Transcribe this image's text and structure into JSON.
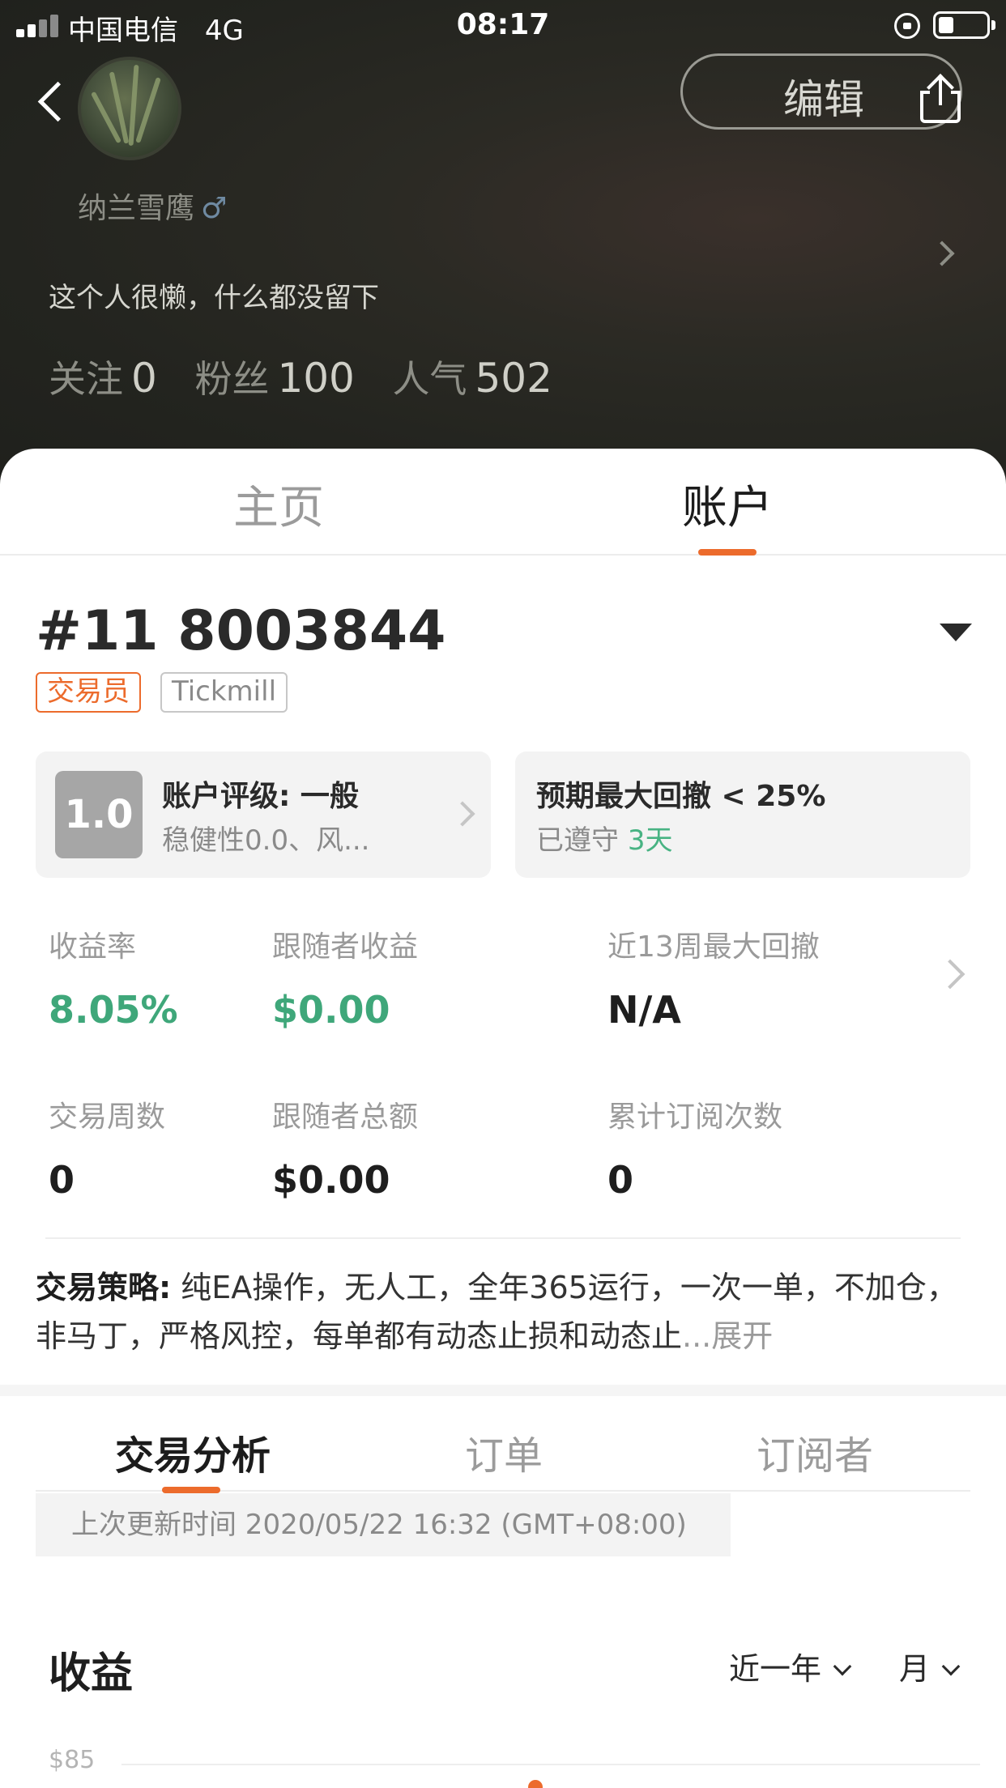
{
  "status_bar": {
    "carrier": "中国电信",
    "network": "4G",
    "time": "08:17"
  },
  "header": {
    "edit_label": "编辑",
    "username": "纳兰雪鹰",
    "gender_symbol": "♂",
    "bio": "这个人很懒，什么都没留下",
    "stats": [
      {
        "label": "关注",
        "value": "0"
      },
      {
        "label": "粉丝",
        "value": "100"
      },
      {
        "label": "人气",
        "value": "502"
      }
    ]
  },
  "top_tabs": [
    {
      "label": "主页",
      "active": false
    },
    {
      "label": "账户",
      "active": true
    }
  ],
  "account": {
    "number": "#11 8003844",
    "role_tag": "交易员",
    "broker_tag": "Tickmill",
    "rating": {
      "score": "1.0",
      "title": "账户评级: 一般",
      "subtitle": "稳健性0.0、风..."
    },
    "drawdown": {
      "title": "预期最大回撤 < 25%",
      "status_prefix": "已遵守",
      "days": "3天"
    }
  },
  "metrics": [
    {
      "label": "收益率",
      "value": "8.05%"
    },
    {
      "label": "跟随者收益",
      "value": "$0.00"
    },
    {
      "label": "近13周最大回撤",
      "value": "N/A"
    },
    {
      "label": "交易周数",
      "value": "0"
    },
    {
      "label": "跟随者总额",
      "value": "$0.00"
    },
    {
      "label": "累计订阅次数",
      "value": "0"
    }
  ],
  "strategy": {
    "label": "交易策略:",
    "text": "纯EA操作，无人工，全年365运行，一次一单，不加仓，非马丁，严格风控，每单都有动态止损和动态止",
    "expand_label": "...展开"
  },
  "sub_tabs": [
    {
      "label": "交易分析",
      "active": true
    },
    {
      "label": "订单",
      "active": false
    },
    {
      "label": "订阅者",
      "active": false
    }
  ],
  "update_text": "上次更新时间 2020/05/22 16:32 (GMT+08:00)",
  "earnings": {
    "title": "收益",
    "period_filter": "近一年",
    "granularity_filter": "月",
    "y_axis_top_label": "$85"
  },
  "colors": {
    "accent": "#ec6b2c",
    "positive": "#3fa77a"
  }
}
